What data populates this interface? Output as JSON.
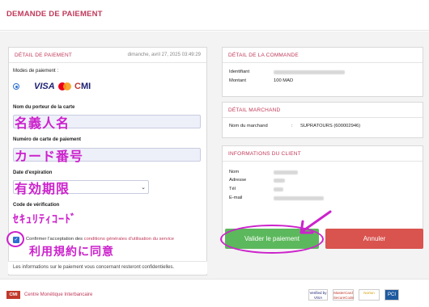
{
  "header": {
    "title": "DEMANDE DE PAIEMENT"
  },
  "payment": {
    "head": "DÉTAIL DE PAIEMENT",
    "date": "dimanche, avril 27, 2025 03:49:29",
    "modes_label": "Modes de paiement :",
    "logos": {
      "visa": "VISA",
      "cmi_c": "C",
      "cmi_rest": "MI"
    },
    "holder_label": "Nom du porteur de la carte",
    "holder_annotation": "名義人名",
    "card_label": "Numéro de carte de paiement",
    "card_annotation": "カード番号",
    "expiry_label": "Date d'expiration",
    "expiry_annotation": "有効期限",
    "expiry_arrow": "⌄",
    "cvv_label": "Code de vérification",
    "cvv_annotation": "ｾｷｭﾘﾃｨｺｰﾄﾞ",
    "terms_prefix": "Confirmer l'acceptation des ",
    "terms_link": "conditions générales d'utilisation du service",
    "terms_annotation": "利用規約に同意",
    "check_mark": "✓",
    "note": "Les informations sur le paiement vous concernant resteront confidentielles."
  },
  "order": {
    "head": "DÉTAIL DE LA COMMANDE",
    "id_label": "Identifiant",
    "amount_label": "Montant",
    "amount_value": "100 MAD"
  },
  "merchant": {
    "head": "DÉTAIL MARCHAND",
    "name_label": "Nom du marchand",
    "separator": ":",
    "name_value": "SUPRATOURS (600002946)"
  },
  "client": {
    "head": "INFORMATIONS DU CLIENT",
    "nom_label": "Nom",
    "adresse_label": "Adresse",
    "tel_label": "Tél",
    "email_label": "E-mail"
  },
  "actions": {
    "validate": "Valider le paiement",
    "cancel": "Annuler"
  },
  "footer": {
    "brand": "CMI",
    "brand_text": "Centre Monétique Interbancaire",
    "badges": [
      "Verified by VISA",
      "MasterCard SecureCode",
      "Norton",
      "PCI"
    ]
  },
  "colors": {
    "accent": "#c0395a",
    "annotation": "#cc22cc",
    "validate": "#5cb85c",
    "cancel": "#d9534f"
  }
}
